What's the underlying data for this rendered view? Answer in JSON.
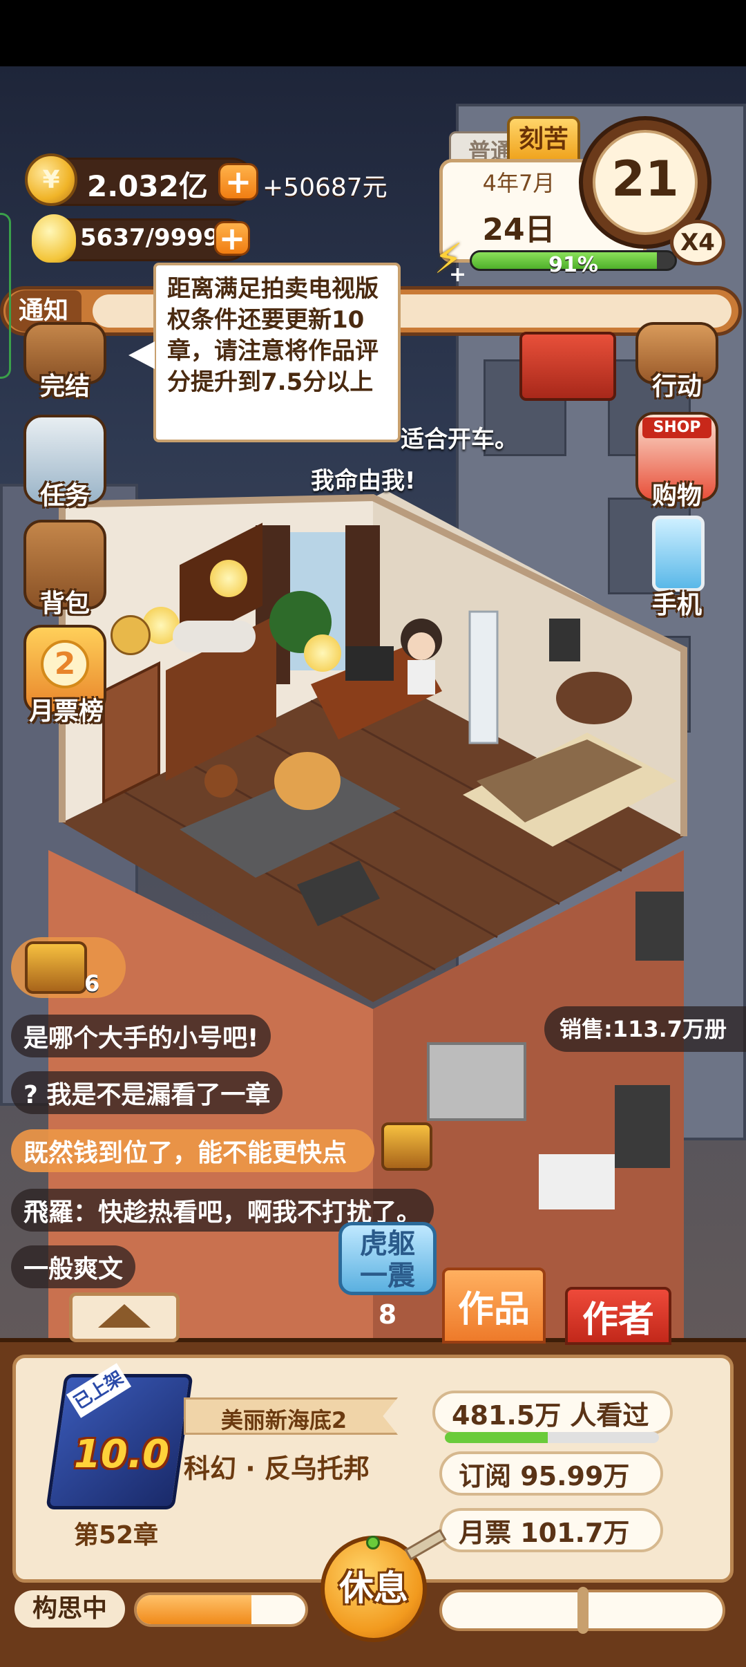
{
  "hud": {
    "gold_amount": "2.032亿",
    "gold_income": "+50687元",
    "gold_coin_symbol": "¥",
    "inspiration": "5637/9999",
    "mode_tab_normal": "普通",
    "mode_tab_hard": "刻苦",
    "date_month": "4年7月",
    "date_day": "24日",
    "energy_percent_label": "91%",
    "energy_fraction": 0.91,
    "timer_value": "21",
    "speed_multiplier": "X4",
    "notice_label": "通知"
  },
  "tooltip": {
    "text": "距离满足拍卖电视版权条件还要更新10章，请注意将作品评分提升到7.5分以上"
  },
  "floating_comments": [
    "适合开车。",
    "我命由我!"
  ],
  "left_menu": [
    {
      "label": "完结",
      "icon": "book-icon"
    },
    {
      "label": "任务",
      "icon": "clipboard-icon"
    },
    {
      "label": "背包",
      "icon": "backpack-icon"
    },
    {
      "label": "月票榜",
      "icon": "ticket-ranking-icon",
      "badge": "2"
    }
  ],
  "right_menu": [
    {
      "label": "行动",
      "icon": "door-icon"
    },
    {
      "label": "购物",
      "icon": "shop-icon",
      "sign": "SHOP"
    },
    {
      "label": "手机",
      "icon": "phone-icon"
    }
  ],
  "treasure": {
    "count": "6"
  },
  "sales": "销售:113.7万册",
  "chat": [
    {
      "text": "是哪个大手的小号吧!",
      "highlight": false
    },
    {
      "text": "? 我是不是漏看了一章",
      "highlight": false
    },
    {
      "text": "既然钱到位了，能不能更快点",
      "highlight": true
    },
    {
      "text": "飛羅：快趁热看吧，啊我不打扰了。",
      "highlight": false
    },
    {
      "text": "一般爽文",
      "highlight": false
    }
  ],
  "skill_button": {
    "label_line1": "虎躯",
    "label_line2": "一震",
    "count": "8"
  },
  "tabs": {
    "works": "作品",
    "author": "作者"
  },
  "book": {
    "status_ribbon": "已上架",
    "rating": "10.0",
    "title": "美丽新海底2",
    "genre": "科幻 · 反乌托邦",
    "chapter": "第52章",
    "views": "481.5万 人看过",
    "views_fraction": 0.48,
    "subscriptions": "订阅  95.99万",
    "monthly_tickets": "月票  101.7万"
  },
  "bottom": {
    "status_label": "构思中",
    "progress_fraction": 0.68,
    "rest_button": "休息"
  },
  "colors": {
    "accent_orange": "#f07d12",
    "energy_green": "#5fc43a",
    "panel_brown": "#6b3a1a",
    "tab_red": "#d8342a"
  }
}
